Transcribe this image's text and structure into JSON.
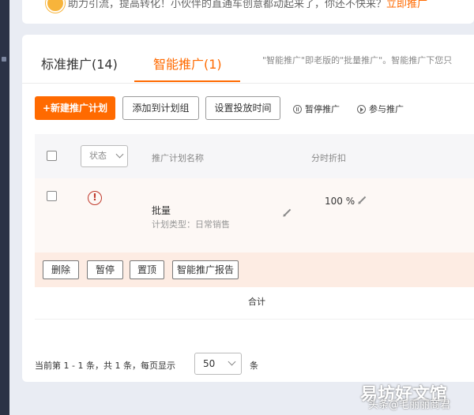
{
  "tip": {
    "text": "助力引流，提高转化！小伙伴的直通车创意都动起来了，你还不快来？",
    "link": "立即推广"
  },
  "tabs": [
    {
      "label": "标准推广(14)",
      "active": false
    },
    {
      "label": "智能推广(1)",
      "active": true
    }
  ],
  "tab_description": "\"智能推广\"即老版的\"批量推广\"。智能推广下您只",
  "toolbar": {
    "new_plan": "+新建推广计划",
    "add_group": "添加到计划组",
    "set_time": "设置投放时间",
    "pause": "暂停推广",
    "join": "参与推广"
  },
  "table": {
    "status_filter": "状态",
    "columns": {
      "name": "推广计划名称",
      "discount": "分时折扣"
    },
    "rows": [
      {
        "name": "批量",
        "type": "计划类型：日常销售",
        "discount": "100 %"
      }
    ]
  },
  "actions": {
    "delete": "删除",
    "pause": "暂停",
    "top": "置顶",
    "report": "智能推广报告"
  },
  "total_label": "合计",
  "pagination": {
    "summary": "当前第 1 - 1 条，共 1 条，每页显示",
    "page_size": "50",
    "unit": "条"
  },
  "watermark": {
    "main": "易坊好文馆",
    "sub": "头条@毛丽丽商君"
  },
  "colors": {
    "accent": "#ff6a00",
    "warning": "#c0392b",
    "row_bg": "#fdf8f5",
    "action_bg": "#fdece3"
  }
}
